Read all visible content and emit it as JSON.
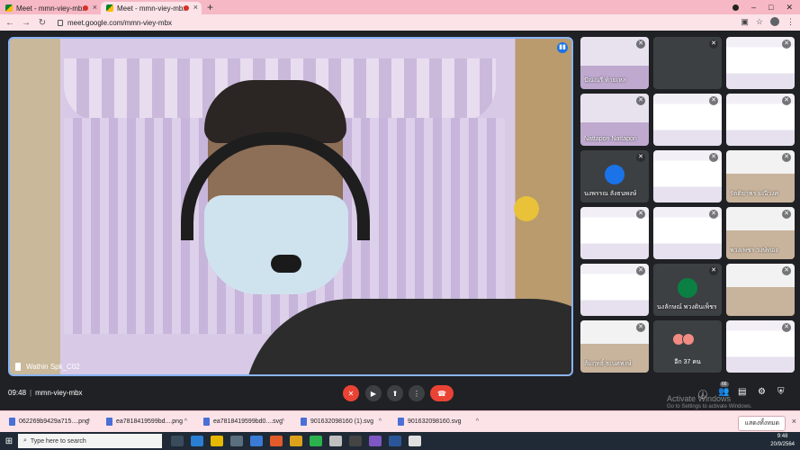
{
  "browser": {
    "tabs": [
      {
        "title": "Meet - mmn-viey-mbx",
        "recording": true,
        "active": false
      },
      {
        "title": "Meet - mmn-viey-mbx",
        "recording": true,
        "active": true
      }
    ],
    "new_tab": "+",
    "url": "meet.google.com/mmn-viey-mbx"
  },
  "meet": {
    "main_speaker": "Wathin Spk_C02",
    "participants": [
      {
        "name": "ปัณณรี ท้ายเหล",
        "kind": "video"
      },
      {
        "name": "",
        "kind": "dark"
      },
      {
        "name": "",
        "kind": "slide"
      },
      {
        "name": "Nattapon Nattapon",
        "kind": "video"
      },
      {
        "name": "",
        "kind": "slide"
      },
      {
        "name": "",
        "kind": "slide"
      },
      {
        "name": "นงพรรณ ลังธนพงษ์",
        "kind": "avatar"
      },
      {
        "name": "",
        "kind": "slide"
      },
      {
        "name": "รัตติยาพร มณีวงศ",
        "kind": "face"
      },
      {
        "name": "",
        "kind": "slide"
      },
      {
        "name": "",
        "kind": "slide"
      },
      {
        "name": "พวงเพชร วงษ์ทอง",
        "kind": "face"
      },
      {
        "name": "",
        "kind": "slide"
      },
      {
        "name": "นงลักษณ์ พวงดินเพ็ชร",
        "kind": "avatar"
      },
      {
        "name": "",
        "kind": "face"
      },
      {
        "name": "ส้มฤทธิ์ ธเนศพงษ์",
        "kind": "face"
      },
      {
        "name": "อีก 37 คน",
        "kind": "more"
      },
      {
        "name": "",
        "kind": "slide"
      }
    ],
    "avatar_colors": [
      "#1a73e8",
      "#0b8043"
    ],
    "meeting_time": "09:48",
    "meeting_code": "mmn-viey-mbx",
    "people_count": "66",
    "activate_title": "Activate Windows",
    "activate_sub": "Go to Settings to activate Windows."
  },
  "downloads": {
    "items": [
      "062269b9429a715....png",
      "ea7818419599bd....png",
      "ea7818419599bd0....svg",
      "901632098160 (1).svg",
      "901632098160.svg"
    ],
    "show_all": "แสดงทั้งหมด"
  },
  "taskbar": {
    "search_placeholder": "Type here to search",
    "time": "9:48",
    "date": "20/9/2564"
  }
}
